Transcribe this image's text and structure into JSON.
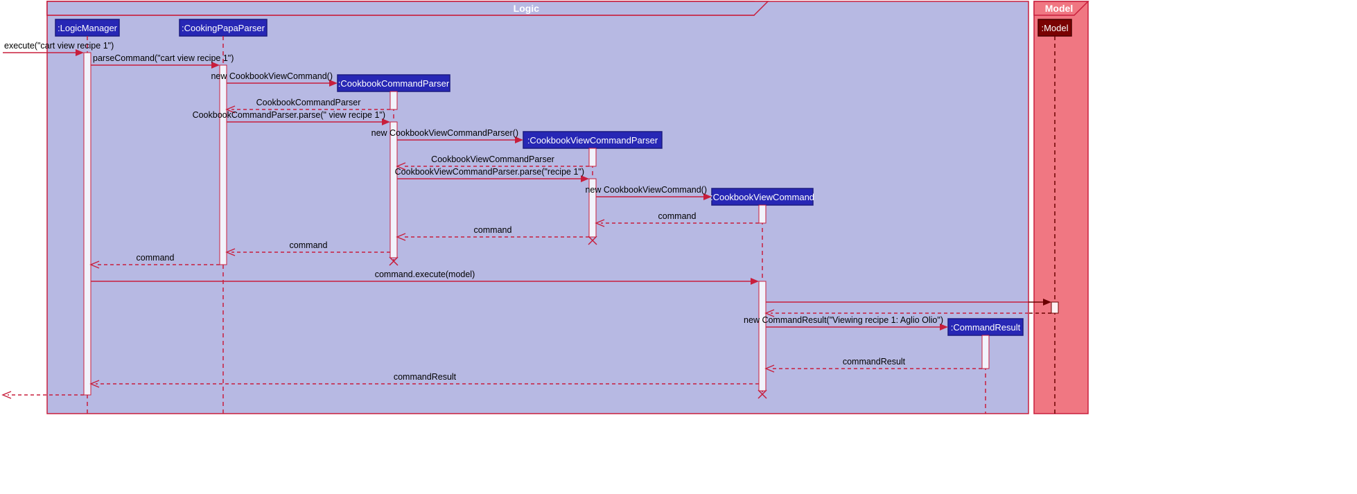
{
  "frames": {
    "logic": {
      "title": "Logic"
    },
    "model": {
      "title": "Model"
    }
  },
  "participants": {
    "logicManager": {
      "label": ":LogicManager"
    },
    "cookingPapaParser": {
      "label": ":CookingPapaParser"
    },
    "cookbookCommandParser": {
      "label": ":CookbookCommandParser"
    },
    "cookbookViewCmdParser": {
      "label": ":CookbookViewCommandParser"
    },
    "cookbookViewCommand": {
      "label": ":CookbookViewCommand"
    },
    "commandResult": {
      "label": ":CommandResult"
    },
    "model": {
      "label": ":Model"
    }
  },
  "messages": {
    "m0": "execute(\"cart view recipe 1\")",
    "m1": "parseCommand(\"cart view recipe 1\")",
    "m2": "new CookbookViewCommand()",
    "m3": "CookbookCommandParser",
    "m4": "CookbookCommandParser.parse(\" view recipe 1\")",
    "m5": "new CookbookViewCommandParser()",
    "m6": "CookbookViewCommandParser",
    "m7": "CookbookViewCommandParser.parse(\"recipe 1\")",
    "m8": "new CookbookViewCommand()",
    "m9": "command",
    "m10": "command",
    "m11": "command",
    "m12": "command",
    "m13": "command.execute(model)",
    "m14": "new CommandResult(\"Viewing recipe 1: Aglio Olio\")",
    "m15": "commandResult",
    "m16": "commandResult"
  }
}
